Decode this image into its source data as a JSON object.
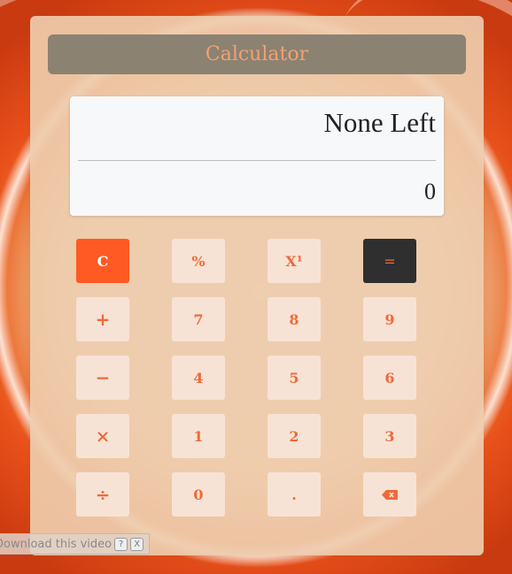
{
  "window": {
    "title": "Calculator"
  },
  "display": {
    "expression": "None Left",
    "result": "0"
  },
  "keys": {
    "clear": "C",
    "percent": "%",
    "power": "X¹",
    "equals": "=",
    "plus": "+",
    "seven": "7",
    "eight": "8",
    "nine": "9",
    "minus": "−",
    "four": "4",
    "five": "5",
    "six": "6",
    "multiply": "×",
    "one": "1",
    "two": "2",
    "three": "3",
    "divide": "÷",
    "zero": "0",
    "decimal": ".",
    "backspace_icon": "backspace-icon"
  },
  "overlay": {
    "download_text": "Download this video",
    "help": "?",
    "close": "X"
  },
  "colors": {
    "accent": "#ff5a23",
    "key_text": "#ee6a3a",
    "key_bg": "#f7e3d5",
    "equals_bg": "#2f2f2f"
  }
}
